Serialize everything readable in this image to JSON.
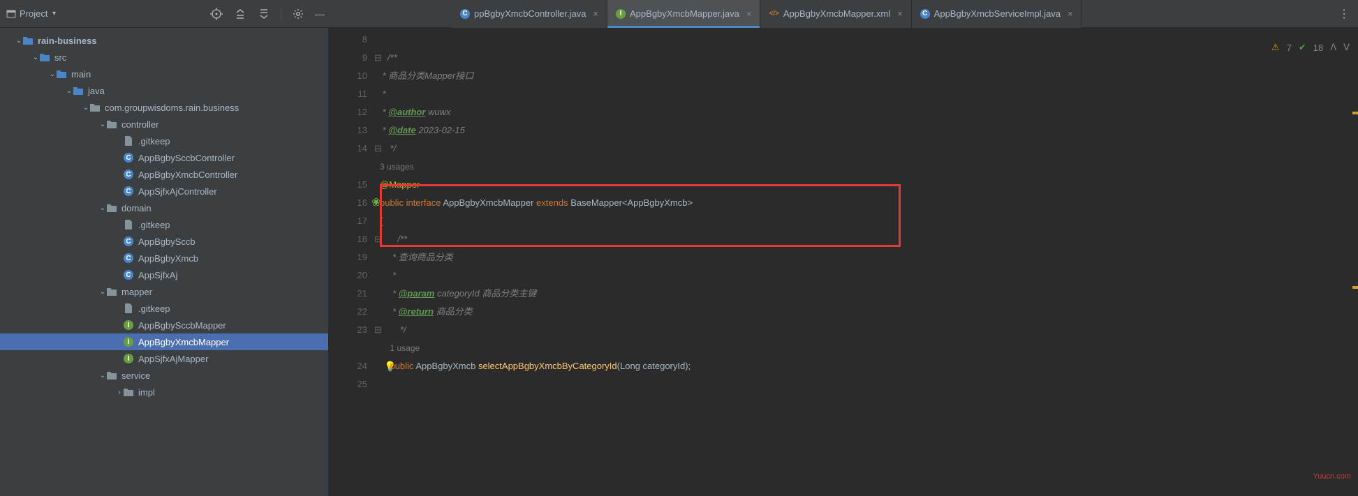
{
  "header": {
    "project_label": "Project",
    "toolbar_icons": [
      "target-icon",
      "collapse-icon",
      "expand-icon",
      "divider",
      "settings-icon",
      "hide-icon"
    ]
  },
  "tabs": [
    {
      "label": "ppBgbyXmcbController.java",
      "icon": "c-blue",
      "active": false
    },
    {
      "label": "AppBgbyXmcbMapper.java",
      "icon": "c-green",
      "active": true
    },
    {
      "label": "AppBgbyXmcbMapper.xml",
      "icon": "xml",
      "active": false
    },
    {
      "label": "AppBgbyXmcbServiceImpl.java",
      "icon": "c-blue",
      "active": false
    }
  ],
  "tree": [
    {
      "depth": 0,
      "chev": "down",
      "icon": "folder-blue",
      "label": "rain-business",
      "bold": true
    },
    {
      "depth": 1,
      "chev": "down",
      "icon": "folder-blue",
      "label": "src"
    },
    {
      "depth": 2,
      "chev": "down",
      "icon": "folder-blue",
      "label": "main"
    },
    {
      "depth": 3,
      "chev": "down",
      "icon": "folder-blue",
      "label": "java"
    },
    {
      "depth": 4,
      "chev": "down",
      "icon": "folder-grey",
      "label": "com.groupwisdoms.rain.business"
    },
    {
      "depth": 5,
      "chev": "down",
      "icon": "folder-grey",
      "label": "controller"
    },
    {
      "depth": 6,
      "chev": "",
      "icon": "file-grey",
      "label": ".gitkeep"
    },
    {
      "depth": 6,
      "chev": "",
      "icon": "c-blue",
      "label": "AppBgbySccbController"
    },
    {
      "depth": 6,
      "chev": "",
      "icon": "c-blue",
      "label": "AppBgbyXmcbController"
    },
    {
      "depth": 6,
      "chev": "",
      "icon": "c-blue",
      "label": "AppSjfxAjController"
    },
    {
      "depth": 5,
      "chev": "down",
      "icon": "folder-grey",
      "label": "domain"
    },
    {
      "depth": 6,
      "chev": "",
      "icon": "file-grey",
      "label": ".gitkeep"
    },
    {
      "depth": 6,
      "chev": "",
      "icon": "c-blue",
      "label": "AppBgbySccb"
    },
    {
      "depth": 6,
      "chev": "",
      "icon": "c-blue",
      "label": "AppBgbyXmcb"
    },
    {
      "depth": 6,
      "chev": "",
      "icon": "c-blue",
      "label": "AppSjfxAj"
    },
    {
      "depth": 5,
      "chev": "down",
      "icon": "folder-grey",
      "label": "mapper"
    },
    {
      "depth": 6,
      "chev": "",
      "icon": "file-grey",
      "label": ".gitkeep"
    },
    {
      "depth": 6,
      "chev": "",
      "icon": "c-green",
      "label": "AppBgbySccbMapper"
    },
    {
      "depth": 6,
      "chev": "",
      "icon": "c-green",
      "label": "AppBgbyXmcbMapper",
      "selected": true
    },
    {
      "depth": 6,
      "chev": "",
      "icon": "c-green",
      "label": "AppSjfxAjMapper"
    },
    {
      "depth": 5,
      "chev": "down",
      "icon": "folder-grey",
      "label": "service"
    },
    {
      "depth": 6,
      "chev": "right",
      "icon": "folder-grey",
      "label": "impl"
    }
  ],
  "inspections": {
    "warnings": "7",
    "passed": "18"
  },
  "code": {
    "lines": [
      {
        "n": "8",
        "html": ""
      },
      {
        "n": "9",
        "html": "<span class='cmt'>/**</span>",
        "foldOpen": true
      },
      {
        "n": "10",
        "html": "<span class='cmt'> * 商品分类Mapper接口</span>"
      },
      {
        "n": "11",
        "html": "<span class='cmt'> *</span>"
      },
      {
        "n": "12",
        "html": "<span class='cmt'> * <span class='tag'>@author</span> wuwx</span>"
      },
      {
        "n": "13",
        "html": "<span class='cmt'> * <span class='tag'>@date</span> 2023-02-15</span>"
      },
      {
        "n": "14",
        "html": "<span class='cmt'> */</span>",
        "foldClose": true
      },
      {
        "n": "",
        "html": "<span class='usages'>3 usages</span>"
      },
      {
        "n": "15",
        "html": "<span class='ann'>@Mapper</span>"
      },
      {
        "n": "16",
        "html": "<span class='kw'>public interface </span><span class='nm'>AppBgbyXmcbMapper </span><span class='kw'>extends </span><span class='nm'>BaseMapper&lt;AppBgbyXmcb&gt;</span>",
        "springIcon": true
      },
      {
        "n": "17",
        "html": "<span class='nm'>{</span>"
      },
      {
        "n": "18",
        "html": "    <span class='cmt'>/**</span>",
        "foldOpen": true
      },
      {
        "n": "19",
        "html": "    <span class='cmt'> * 查询商品分类</span>"
      },
      {
        "n": "20",
        "html": "    <span class='cmt'> *</span>"
      },
      {
        "n": "21",
        "html": "    <span class='cmt'> * <span class='tag'>@param</span> categoryId 商品分类主键</span>"
      },
      {
        "n": "22",
        "html": "    <span class='cmt'> * <span class='tag'>@return</span> 商品分类</span>"
      },
      {
        "n": "23",
        "html": "    <span class='cmt'> */</span>",
        "foldClose": true
      },
      {
        "n": "",
        "html": "    <span class='usages'>1 usage</span>"
      },
      {
        "n": "24",
        "html": "    <span class='kw'>public </span><span class='nm'>AppBgbyXmcb </span><span class='fn'>selectAppBgbyXmcbByCategoryId</span><span class='nm'>(Long categoryId);</span>",
        "bulb": true
      },
      {
        "n": "25",
        "html": ""
      }
    ]
  },
  "watermark": "Yuucn.com"
}
